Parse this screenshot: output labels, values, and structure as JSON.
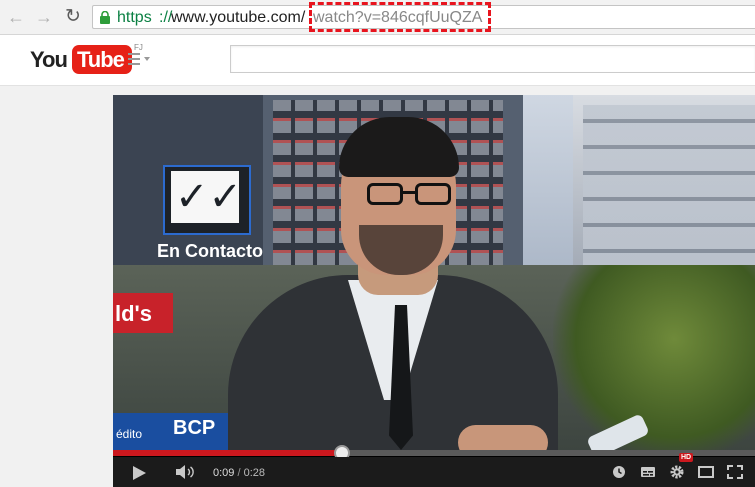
{
  "browser": {
    "url_scheme": "https",
    "url_sep": "://",
    "url_domain": "www.youtube.com/",
    "url_path": "watch?v=846cqfUuQZA",
    "highlight_color": "#e8141e"
  },
  "youtube": {
    "logo_you": "You",
    "logo_tube": "Tube",
    "country_code": "FJ",
    "search_placeholder": ""
  },
  "video": {
    "sign_logo_caption": "En Contacto",
    "shop_sign": "ld's",
    "bank_sign": "BCP",
    "bank_sub": "édito"
  },
  "player": {
    "current_time": "0:09",
    "time_separator": " / ",
    "total_time": "0:28",
    "progress_fraction": 0.357,
    "hd_badge": "HD",
    "accent_color": "#cc181e"
  }
}
